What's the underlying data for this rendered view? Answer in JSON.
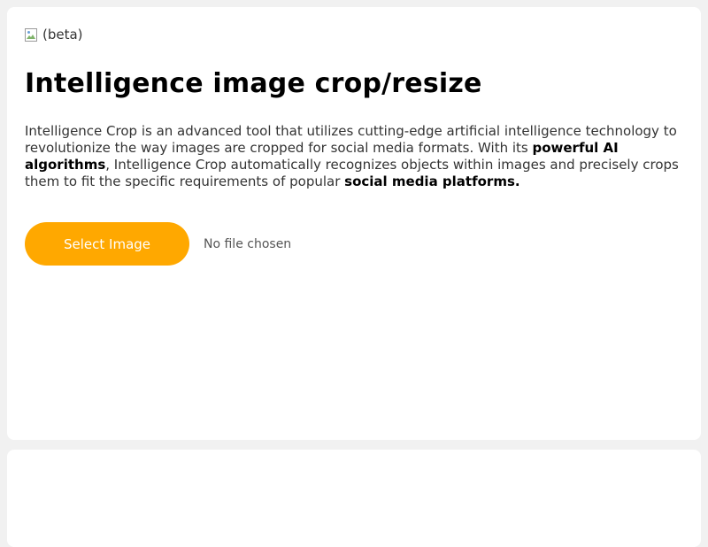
{
  "header": {
    "badge_text": "(beta)",
    "title": "Intelligence image crop/resize"
  },
  "description": {
    "part1": "Intelligence Crop is an advanced tool that utilizes cutting-edge artificial intelligence technology to revolutionize the way images are cropped for social media formats. With its ",
    "bold1": "powerful AI algorithms",
    "part2": ", Intelligence Crop automatically recognizes objects within images and precisely crops them to fit the specific requirements of popular ",
    "bold2": "social media platforms."
  },
  "upload": {
    "button_label": "Select Image",
    "file_status": "No file chosen"
  },
  "colors": {
    "accent": "#ffa800",
    "background": "#f1f1f1",
    "card": "#ffffff"
  },
  "icons": {
    "badge_image": "broken-image-icon"
  }
}
